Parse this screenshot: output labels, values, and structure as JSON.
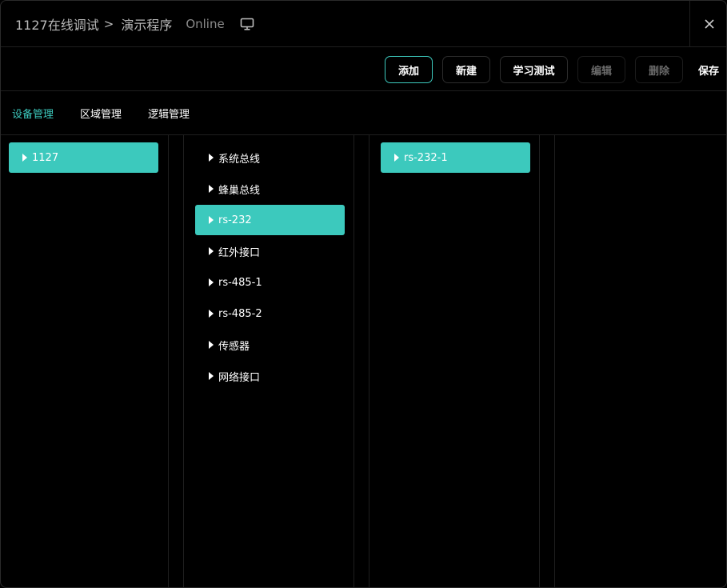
{
  "header": {
    "crumbs": [
      "1127在线调试",
      "演示程序"
    ],
    "separator": ">",
    "status": "Online",
    "status_icon": "monitor-icon",
    "close_icon": "close-icon"
  },
  "toolbar": {
    "add_label": "添加",
    "new_label": "新建",
    "learn_test_label": "学习测试",
    "edit_label": "编辑",
    "delete_label": "删除",
    "save_label": "保存"
  },
  "tabs": [
    {
      "label": "设备管理",
      "active": true
    },
    {
      "label": "区域管理",
      "active": false
    },
    {
      "label": "逻辑管理",
      "active": false
    }
  ],
  "columns": {
    "devices": [
      {
        "label": "1127",
        "selected": true
      }
    ],
    "interfaces": [
      {
        "label": "系统总线",
        "selected": false
      },
      {
        "label": "蜂巢总线",
        "selected": false
      },
      {
        "label": "rs-232",
        "selected": true
      },
      {
        "label": "红外接口",
        "selected": false
      },
      {
        "label": "rs-485-1",
        "selected": false
      },
      {
        "label": "rs-485-2",
        "selected": false
      },
      {
        "label": "传感器",
        "selected": false
      },
      {
        "label": "网络接口",
        "selected": false
      }
    ],
    "channels": [
      {
        "label": "rs-232-1",
        "selected": true
      }
    ]
  },
  "colors": {
    "accent": "#3cc9bd",
    "background": "#000000",
    "divider": "#1f1f1f",
    "disabled_text": "#6b6b6b"
  }
}
